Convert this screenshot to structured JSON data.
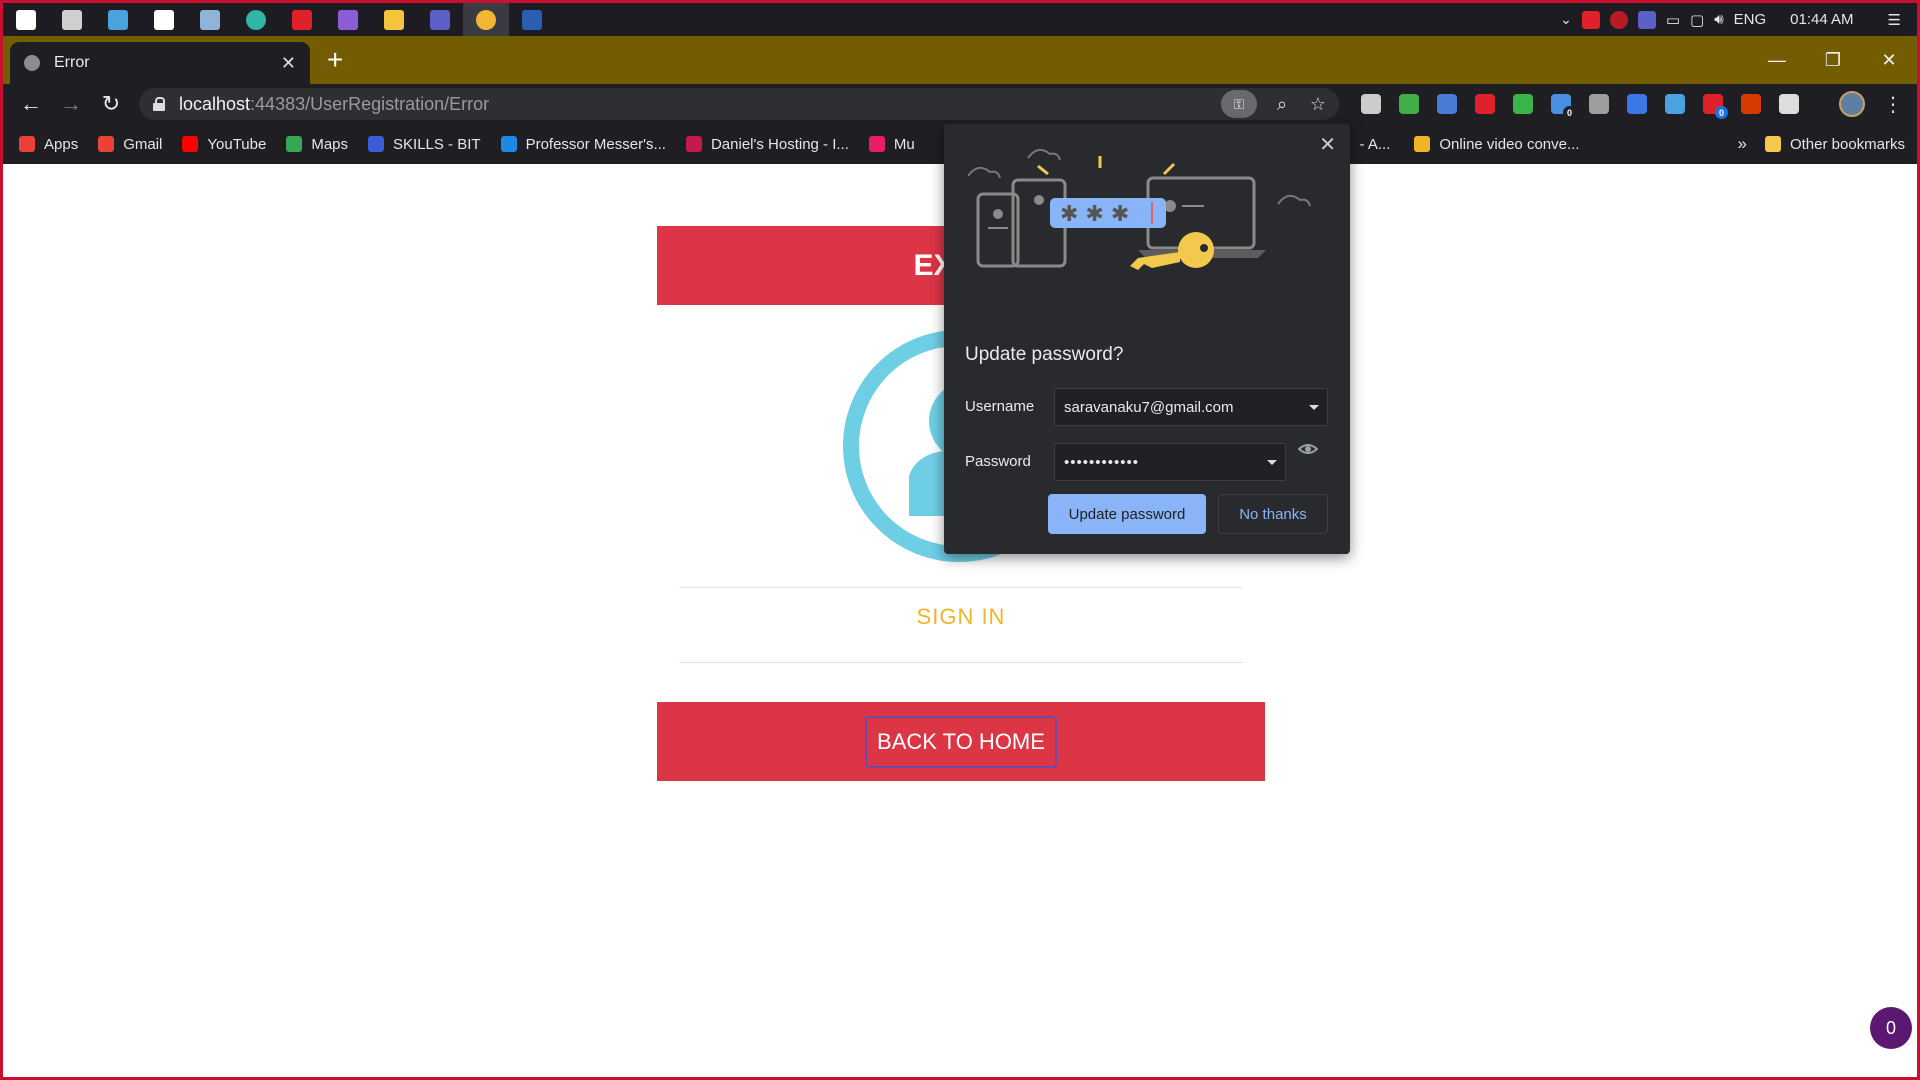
{
  "taskbar": {
    "apps": [
      {
        "name": "windows-start-icon",
        "color": "#ffffff"
      },
      {
        "name": "task-view-icon",
        "color": "#cfcfcf"
      },
      {
        "name": "pc-icon",
        "color": "#4aa3df"
      },
      {
        "name": "notion-icon",
        "color": "#ffffff"
      },
      {
        "name": "photos-icon",
        "color": "#8fb4d8"
      },
      {
        "name": "edge-icon",
        "color": "#2fb7a3"
      },
      {
        "name": "red-app-icon",
        "color": "#e0202a"
      },
      {
        "name": "visual-studio-icon",
        "color": "#8a5cd6"
      },
      {
        "name": "file-explorer-icon",
        "color": "#f3c43c"
      },
      {
        "name": "teams-icon",
        "color": "#5b5fc7"
      },
      {
        "name": "chrome-icon",
        "color": "#f2b632"
      },
      {
        "name": "word-icon",
        "color": "#2b5fb4"
      }
    ],
    "language": "ENG",
    "time": "01:44 AM"
  },
  "tab": {
    "title": "Error"
  },
  "address": {
    "host": "localhost",
    "rest": ":44383/UserRegistration/Error"
  },
  "extensions": [
    {
      "name": "cloud-extension-icon",
      "color": "#cccccc",
      "badge": ""
    },
    {
      "name": "globe-extension-icon",
      "color": "#3fae49",
      "badge": ""
    },
    {
      "name": "pin-extension-icon",
      "color": "#4a7bd6",
      "badge": ""
    },
    {
      "name": "youtube-extension-icon",
      "color": "#e0202a",
      "badge": ""
    },
    {
      "name": "green-extension-icon",
      "color": "#39b54a",
      "badge": ""
    },
    {
      "name": "ghost-extension-icon",
      "color": "#4a90e2",
      "badge": "0"
    },
    {
      "name": "drive-extension-icon",
      "color": "#9e9e9e",
      "badge": ""
    },
    {
      "name": "translate-extension-icon",
      "color": "#3b78e7",
      "badge": ""
    },
    {
      "name": "wave-extension-icon",
      "color": "#4aa3df",
      "badge": ""
    },
    {
      "name": "shield-extension-icon",
      "color": "#e0202a",
      "badge": "0"
    },
    {
      "name": "office-extension-icon",
      "color": "#d83b01",
      "badge": ""
    },
    {
      "name": "puzzle-extension-icon",
      "color": "#dddddd",
      "badge": ""
    }
  ],
  "bookmarks": [
    {
      "label": "Apps",
      "icon": "apps-grid-icon",
      "color": "#e94235"
    },
    {
      "label": "Gmail",
      "icon": "gmail-icon",
      "color": "#ea4335"
    },
    {
      "label": "YouTube",
      "icon": "youtube-icon",
      "color": "#ff0000"
    },
    {
      "label": "Maps",
      "icon": "maps-icon",
      "color": "#34a853"
    },
    {
      "label": "SKILLS - BIT",
      "icon": "skills-icon",
      "color": "#3c5bd6"
    },
    {
      "label": "Professor Messer's...",
      "icon": "professor-messer-icon",
      "color": "#1e88e5"
    },
    {
      "label": "Daniel's Hosting - I...",
      "icon": "raspberry-icon",
      "color": "#c51a4a"
    },
    {
      "label": "Mu",
      "icon": "bow-icon",
      "color": "#e91e63"
    }
  ],
  "bookmarks_right": {
    "hidden_label": "- A...",
    "online": "Online video conve...",
    "overflow": "»",
    "other": "Other bookmarks"
  },
  "page": {
    "hero_text": "EXISTI",
    "signin": "SIGN IN",
    "back_home": "BACK TO HOME",
    "fab_count": "0"
  },
  "popup": {
    "title": "Update password?",
    "username_label": "Username",
    "username_value": "saravanaku7@gmail.com",
    "password_label": "Password",
    "password_value": "••••••••••••",
    "update_button": "Update password",
    "no_thanks_button": "No thanks"
  },
  "colors": {
    "tab_strip": "#745c03",
    "hero": "#dc3545",
    "signin": "#f0b429",
    "popup_bg": "#292a2d",
    "accent": "#8ab4f8"
  }
}
